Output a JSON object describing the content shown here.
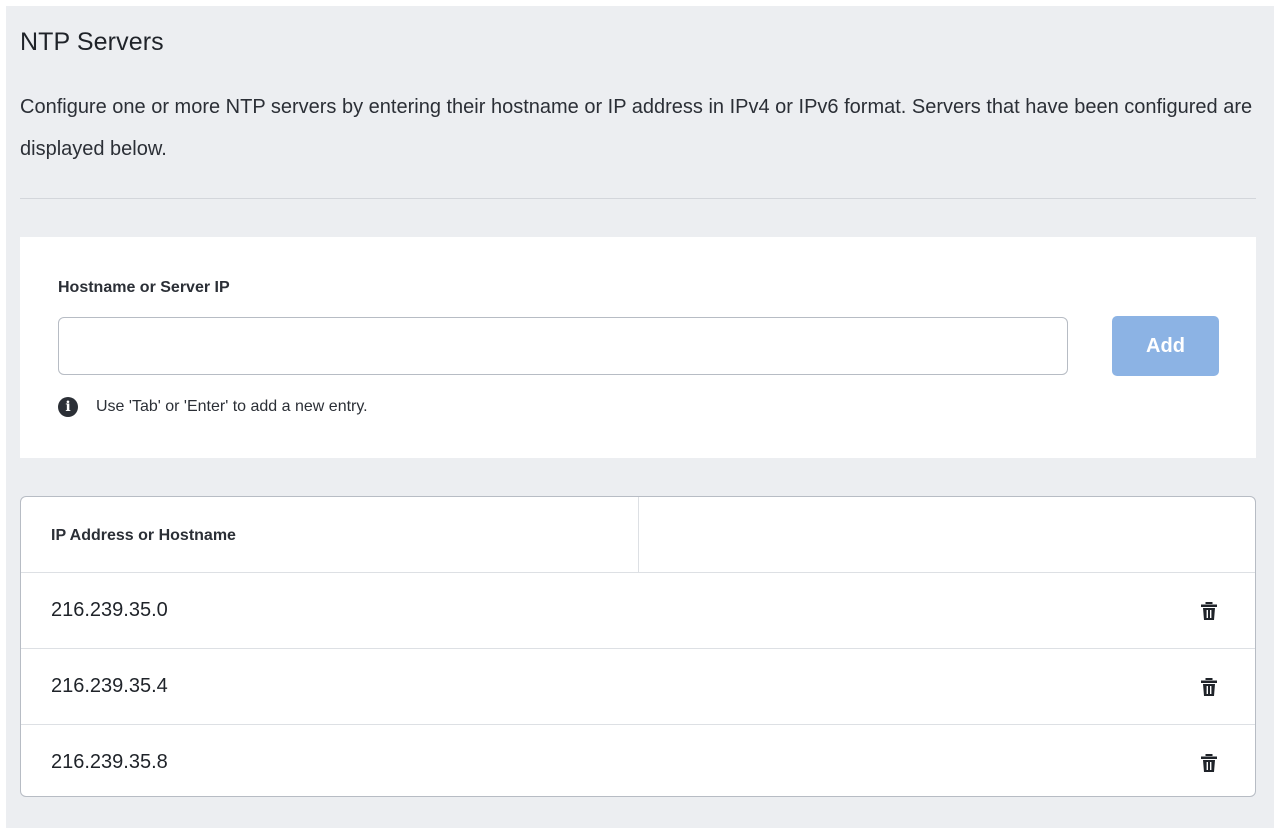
{
  "section": {
    "title": "NTP Servers",
    "description": "Configure one or more NTP servers by entering their hostname or IP address in IPv4 or IPv6 format. Servers that have been configured are displayed below."
  },
  "form": {
    "field_label": "Hostname or Server IP",
    "input_value": "",
    "input_placeholder": "",
    "add_label": "Add",
    "hint": "Use 'Tab' or 'Enter' to add a new entry.",
    "info_icon": "info-icon",
    "add_button_color": "#8cb3e4"
  },
  "table": {
    "columns": [
      "IP Address or Hostname",
      ""
    ],
    "rows": [
      {
        "address": "216.239.35.0",
        "action_icon": "trash-icon"
      },
      {
        "address": "216.239.35.4",
        "action_icon": "trash-icon"
      },
      {
        "address": "216.239.35.8",
        "action_icon": "trash-icon"
      }
    ]
  }
}
